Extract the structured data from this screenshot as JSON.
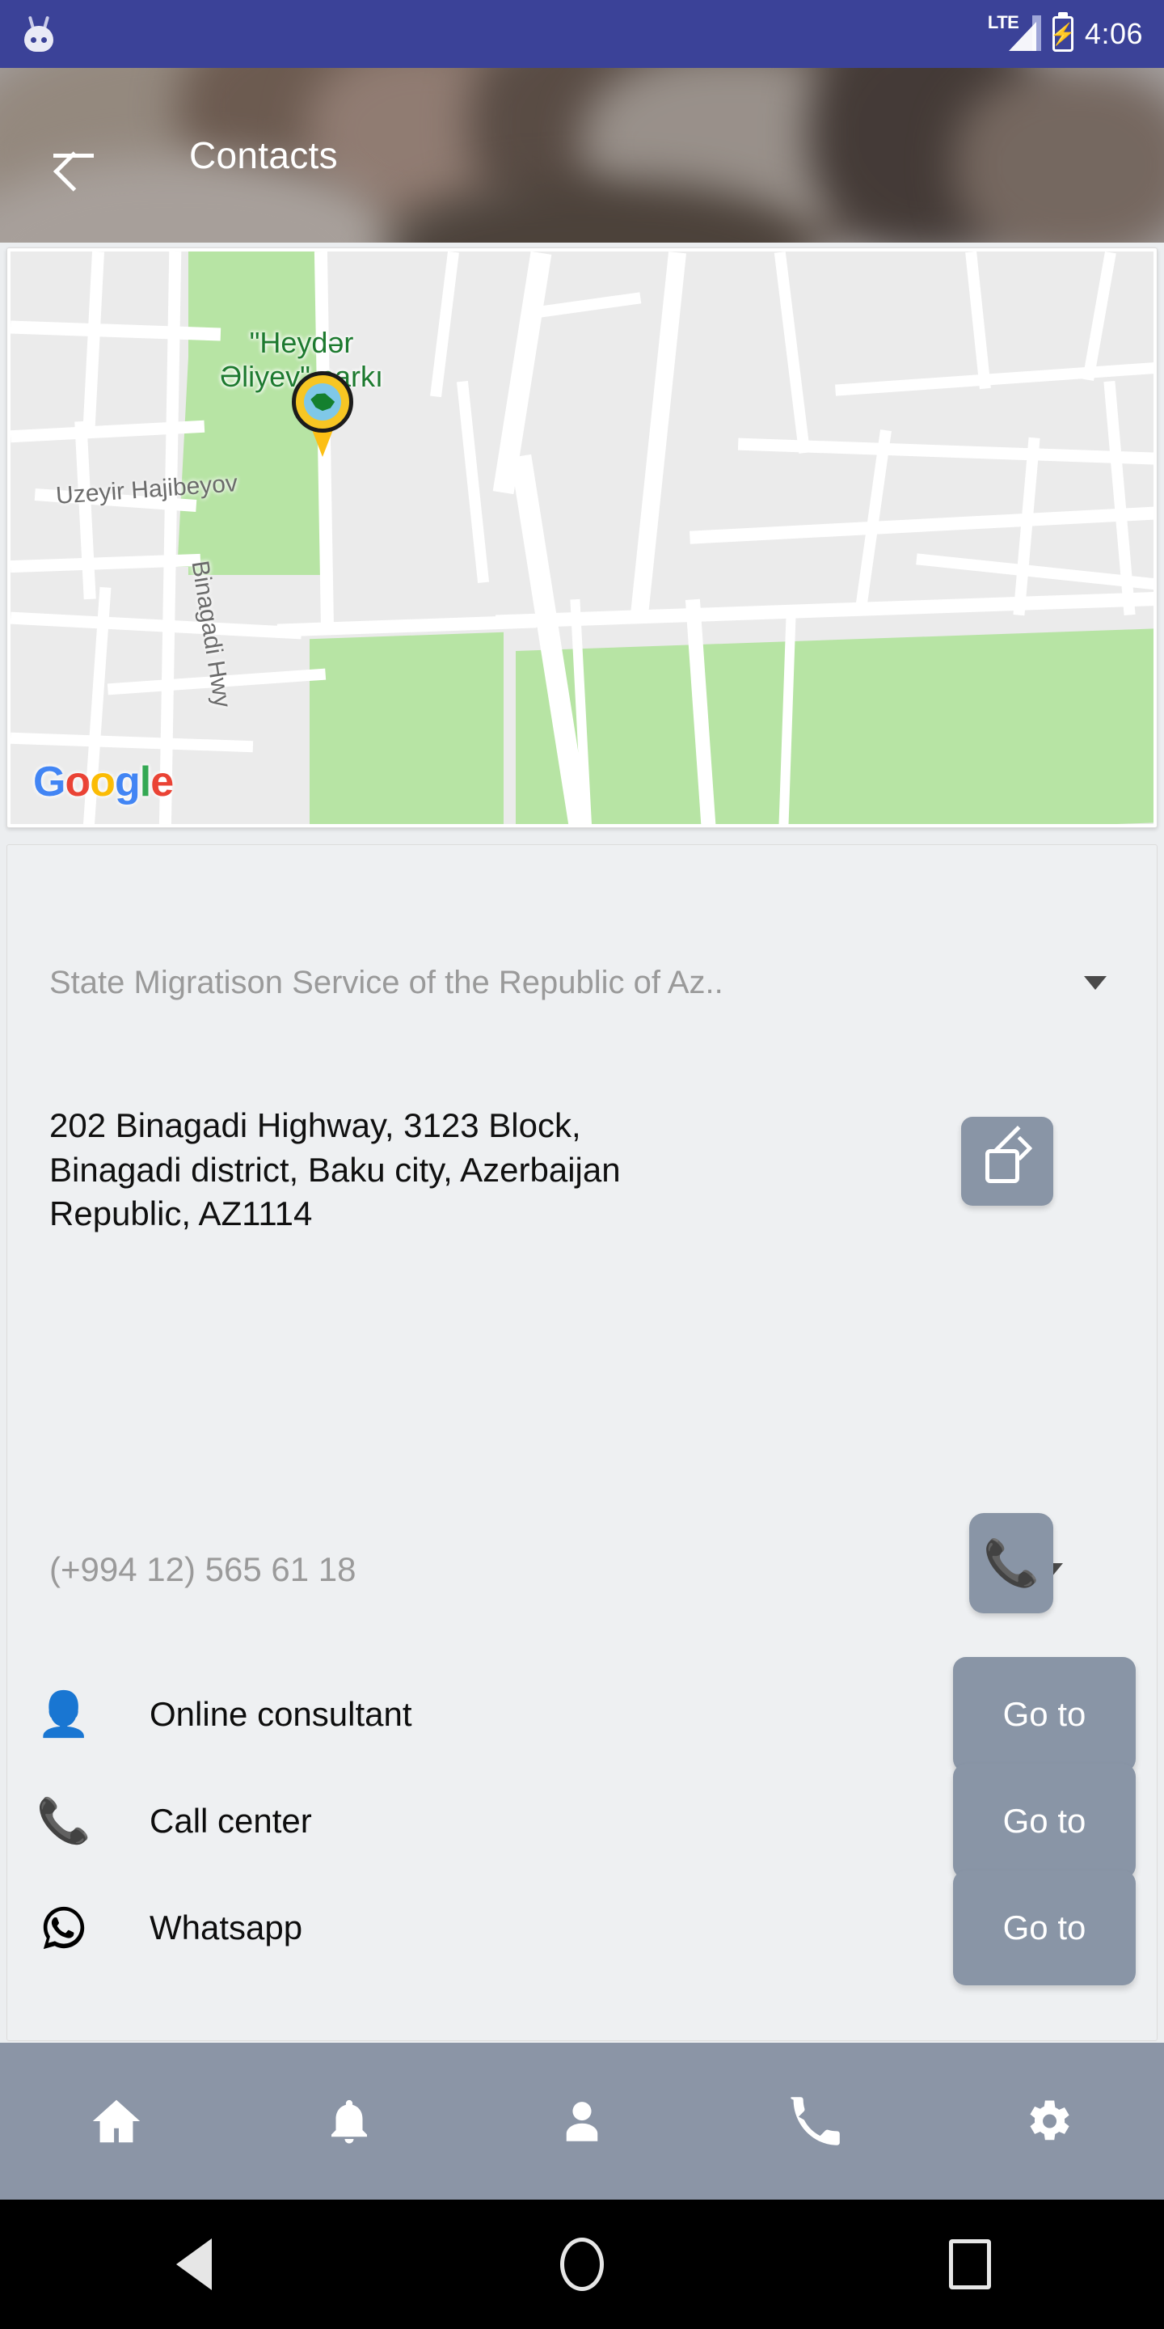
{
  "status_bar": {
    "carrier_tech": "LTE",
    "time": "4:06",
    "battery_icon": "battery-charging-icon",
    "signal_icon": "signal-bars-icon",
    "os_icon": "cyanogenmod-robot-icon",
    "background_color": "#3b4298"
  },
  "app_bar": {
    "title": "Contacts",
    "back_icon": "arrow-back-icon"
  },
  "map": {
    "provider_logo": [
      "G",
      "o",
      "o",
      "g",
      "l",
      "e"
    ],
    "park_label": "\"Heydər Əliyev\" parkı",
    "park_label_line1": "\"Heydər",
    "park_label_line2": "Əliyev\" parkı",
    "street_label_1": "Uzeyir Hajibeyov",
    "street_label_2": "Binagadi Hwy",
    "marker_icon": "location-pin-emblem-icon",
    "park_color": "#b7e4a4",
    "road_color": "#ffffff",
    "land_color": "#ebebeb",
    "label_color": "#1d7a2f"
  },
  "details": {
    "organization": "State Migratison Service of the Republic of Az..",
    "organization_caret_icon": "chevron-down-icon",
    "address_lines": [
      "202 Binagadi Highway, 3123 Block,",
      "Binagadi district, Baku city, Azerbaijan",
      "Republic, AZ1114"
    ],
    "open_map_button_icon": "open-external-icon",
    "phone": "(+994 12) 565 61 18",
    "phone_caret_icon": "chevron-down-icon",
    "call_button_icon": "phone-icon",
    "links": [
      {
        "label": "Online consultant",
        "icon": "person-icon",
        "icon_color": "#069a06",
        "action_label": "Go to"
      },
      {
        "label": "Call center",
        "icon": "phone-icon",
        "icon_color": "#0d0d0d",
        "action_label": "Go to"
      },
      {
        "label": "Whatsapp",
        "icon": "whatsapp-icon",
        "icon_color": "#0d0d0d",
        "action_label": "Go to"
      }
    ],
    "button_color": "#8995a6"
  },
  "bottom_nav": {
    "background_color": "#8b95a6",
    "items": [
      {
        "icon": "home-icon",
        "glyph": "⌂"
      },
      {
        "icon": "bell-icon",
        "glyph": "🔔"
      },
      {
        "icon": "person-icon",
        "glyph": "👤"
      },
      {
        "icon": "phone-icon",
        "glyph": "📞"
      },
      {
        "icon": "gear-icon",
        "glyph": "⚙"
      }
    ]
  },
  "system_nav": {
    "back_icon": "triangle-back-icon",
    "home_icon": "circle-home-icon",
    "recents_icon": "square-recents-icon"
  }
}
